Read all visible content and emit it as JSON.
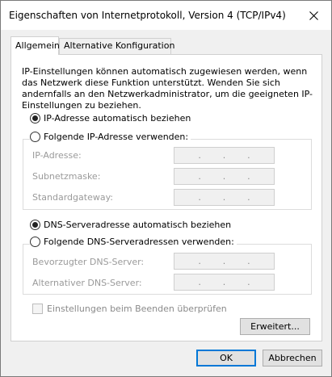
{
  "window": {
    "title": "Eigenschaften von Internetprotokoll, Version 4 (TCP/IPv4)"
  },
  "tabs": [
    {
      "label": "Allgemein",
      "active": true
    },
    {
      "label": "Alternative Konfiguration",
      "active": false
    }
  ],
  "info_text": "IP-Einstellungen können automatisch zugewiesen werden, wenn das Netzwerk diese Funktion unterstützt. Wenden Sie sich andernfalls an den Netzwerkadministrator, um die geeigneten IP-Einstellungen zu beziehen.",
  "ip": {
    "auto_label": "IP-Adresse automatisch beziehen",
    "auto_selected": true,
    "manual_label": "Folgende IP-Adresse verwenden:",
    "fields": [
      {
        "label": "IP-Adresse:"
      },
      {
        "label": "Subnetzmaske:"
      },
      {
        "label": "Standardgateway:"
      }
    ]
  },
  "dns": {
    "auto_label": "DNS-Serveradresse automatisch beziehen",
    "auto_selected": true,
    "manual_label": "Folgende DNS-Serveradressen verwenden:",
    "fields": [
      {
        "label": "Bevorzugter DNS-Server:"
      },
      {
        "label": "Alternativer DNS-Server:"
      }
    ]
  },
  "ip_dot": ".",
  "validate_label": "Einstellungen beim Beenden überprüfen",
  "buttons": {
    "advanced": "Erweitert...",
    "ok": "OK",
    "cancel": "Abbrechen"
  }
}
